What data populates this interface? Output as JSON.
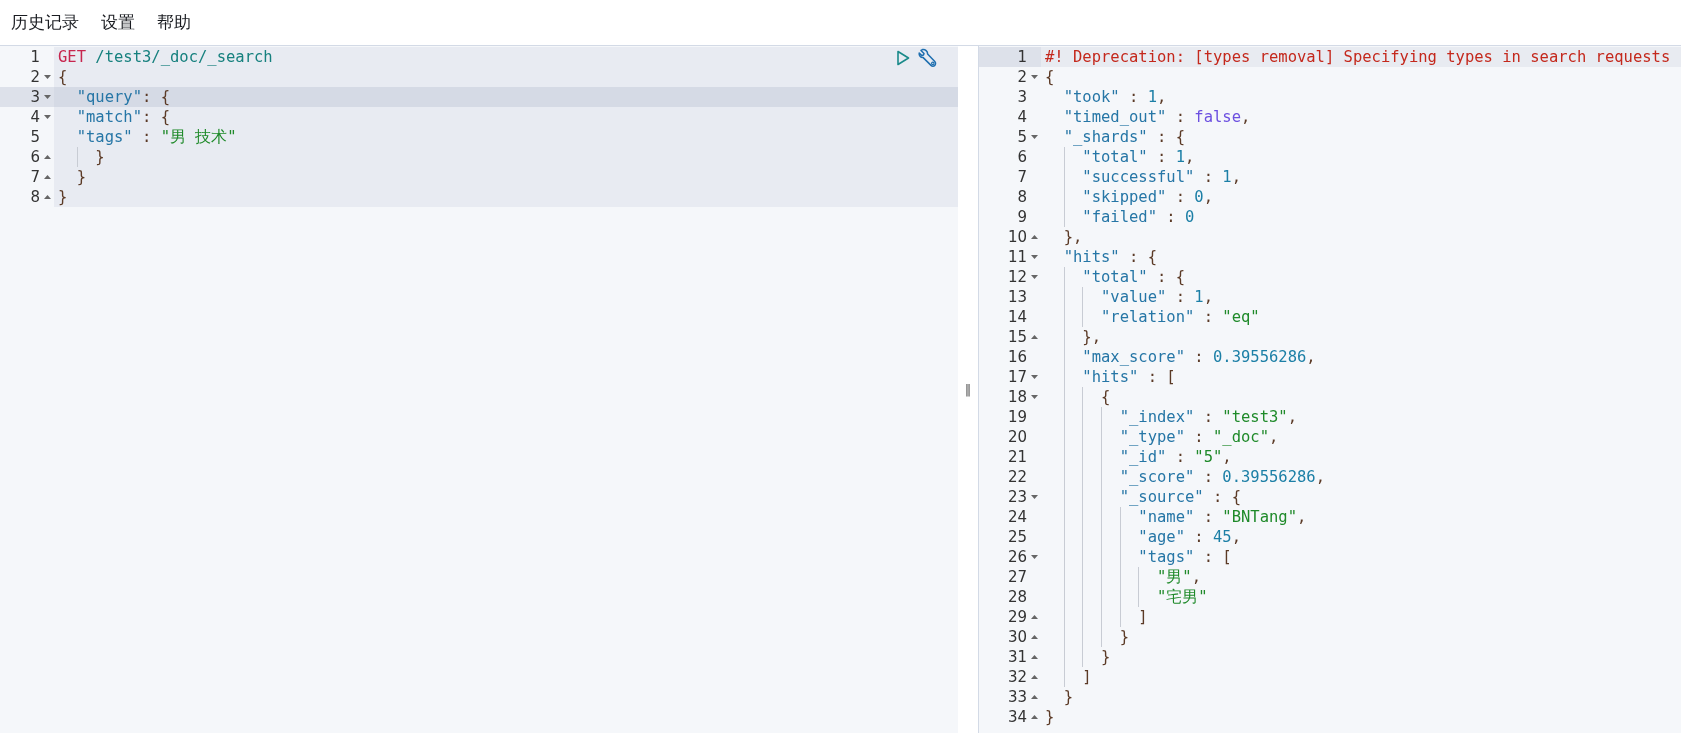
{
  "menu": [
    {
      "label": "历史记录"
    },
    {
      "label": "设置"
    },
    {
      "label": "帮助"
    }
  ],
  "request": {
    "selected": true,
    "lines": [
      {
        "number": "1",
        "active": false,
        "tokens": [
          {
            "kind": "method",
            "text": "GET"
          },
          {
            "kind": "url",
            "text": " /test3/_doc/_search"
          }
        ]
      },
      {
        "number": "2",
        "active": false,
        "expanded": true,
        "tokens": [
          {
            "kind": "punct",
            "text": "{"
          }
        ]
      },
      {
        "number": "3",
        "active": true,
        "expanded": true,
        "tokens": [
          {
            "kind": "key",
            "text": "  \"query\""
          },
          {
            "kind": "punct",
            "text": ": {"
          }
        ]
      },
      {
        "number": "4",
        "active": false,
        "expanded": true,
        "tokens": [
          {
            "kind": "key",
            "text": "  \"match\""
          },
          {
            "kind": "punct",
            "text": ": {"
          }
        ]
      },
      {
        "number": "5",
        "active": false,
        "tokens": [
          {
            "kind": "key",
            "text": "  \"tags\""
          },
          {
            "kind": "punct",
            "text": " : "
          },
          {
            "kind": "string",
            "text": "\"男 技术\""
          }
        ]
      },
      {
        "number": "6",
        "active": false,
        "expanded": false,
        "tokens": [
          {
            "kind": "punct",
            "text": "    }"
          }
        ]
      },
      {
        "number": "7",
        "active": false,
        "expanded": false,
        "tokens": [
          {
            "kind": "punct",
            "text": "  }"
          }
        ]
      },
      {
        "number": "8",
        "active": false,
        "expanded": false,
        "tokens": [
          {
            "kind": "punct",
            "text": "}"
          }
        ]
      }
    ]
  },
  "resize_handle": "‖",
  "response": {
    "lines": [
      {
        "number": "1",
        "active": true,
        "tokens": [
          {
            "kind": "comment",
            "text": "#! Deprecation: [types removal] Specifying types in search requests"
          }
        ]
      },
      {
        "number": "2",
        "active": false,
        "expanded": true,
        "tokens": [
          {
            "kind": "punct",
            "text": "{"
          }
        ]
      },
      {
        "number": "3",
        "active": false,
        "tokens": [
          {
            "kind": "key",
            "text": "  \"took\""
          },
          {
            "kind": "punct",
            "text": " : "
          },
          {
            "kind": "number",
            "text": "1"
          },
          {
            "kind": "punct",
            "text": ","
          }
        ]
      },
      {
        "number": "4",
        "active": false,
        "tokens": [
          {
            "kind": "key",
            "text": "  \"timed_out\""
          },
          {
            "kind": "punct",
            "text": " : "
          },
          {
            "kind": "boolean",
            "text": "false"
          },
          {
            "kind": "punct",
            "text": ","
          }
        ]
      },
      {
        "number": "5",
        "active": false,
        "expanded": true,
        "tokens": [
          {
            "kind": "key",
            "text": "  \"_shards\""
          },
          {
            "kind": "punct",
            "text": " : {"
          }
        ]
      },
      {
        "number": "6",
        "active": false,
        "tokens": [
          {
            "kind": "key",
            "text": "    \"total\""
          },
          {
            "kind": "punct",
            "text": " : "
          },
          {
            "kind": "number",
            "text": "1"
          },
          {
            "kind": "punct",
            "text": ","
          }
        ]
      },
      {
        "number": "7",
        "active": false,
        "tokens": [
          {
            "kind": "key",
            "text": "    \"successful\""
          },
          {
            "kind": "punct",
            "text": " : "
          },
          {
            "kind": "number",
            "text": "1"
          },
          {
            "kind": "punct",
            "text": ","
          }
        ]
      },
      {
        "number": "8",
        "active": false,
        "tokens": [
          {
            "kind": "key",
            "text": "    \"skipped\""
          },
          {
            "kind": "punct",
            "text": " : "
          },
          {
            "kind": "number",
            "text": "0"
          },
          {
            "kind": "punct",
            "text": ","
          }
        ]
      },
      {
        "number": "9",
        "active": false,
        "tokens": [
          {
            "kind": "key",
            "text": "    \"failed\""
          },
          {
            "kind": "punct",
            "text": " : "
          },
          {
            "kind": "number",
            "text": "0"
          }
        ]
      },
      {
        "number": "10",
        "active": false,
        "expanded": false,
        "tokens": [
          {
            "kind": "punct",
            "text": "  },"
          }
        ]
      },
      {
        "number": "11",
        "active": false,
        "expanded": true,
        "tokens": [
          {
            "kind": "key",
            "text": "  \"hits\""
          },
          {
            "kind": "punct",
            "text": " : {"
          }
        ]
      },
      {
        "number": "12",
        "active": false,
        "expanded": true,
        "tokens": [
          {
            "kind": "key",
            "text": "    \"total\""
          },
          {
            "kind": "punct",
            "text": " : {"
          }
        ]
      },
      {
        "number": "13",
        "active": false,
        "tokens": [
          {
            "kind": "key",
            "text": "      \"value\""
          },
          {
            "kind": "punct",
            "text": " : "
          },
          {
            "kind": "number",
            "text": "1"
          },
          {
            "kind": "punct",
            "text": ","
          }
        ]
      },
      {
        "number": "14",
        "active": false,
        "tokens": [
          {
            "kind": "key",
            "text": "      \"relation\""
          },
          {
            "kind": "punct",
            "text": " : "
          },
          {
            "kind": "string",
            "text": "\"eq\""
          }
        ]
      },
      {
        "number": "15",
        "active": false,
        "expanded": false,
        "tokens": [
          {
            "kind": "punct",
            "text": "    },"
          }
        ]
      },
      {
        "number": "16",
        "active": false,
        "tokens": [
          {
            "kind": "key",
            "text": "    \"max_score\""
          },
          {
            "kind": "punct",
            "text": " : "
          },
          {
            "kind": "number",
            "text": "0.39556286"
          },
          {
            "kind": "punct",
            "text": ","
          }
        ]
      },
      {
        "number": "17",
        "active": false,
        "expanded": true,
        "tokens": [
          {
            "kind": "key",
            "text": "    \"hits\""
          },
          {
            "kind": "punct",
            "text": " : ["
          }
        ]
      },
      {
        "number": "18",
        "active": false,
        "expanded": true,
        "tokens": [
          {
            "kind": "punct",
            "text": "      {"
          }
        ]
      },
      {
        "number": "19",
        "active": false,
        "tokens": [
          {
            "kind": "key",
            "text": "        \"_index\""
          },
          {
            "kind": "punct",
            "text": " : "
          },
          {
            "kind": "string",
            "text": "\"test3\""
          },
          {
            "kind": "punct",
            "text": ","
          }
        ]
      },
      {
        "number": "20",
        "active": false,
        "tokens": [
          {
            "kind": "key",
            "text": "        \"_type\""
          },
          {
            "kind": "punct",
            "text": " : "
          },
          {
            "kind": "string",
            "text": "\"_doc\""
          },
          {
            "kind": "punct",
            "text": ","
          }
        ]
      },
      {
        "number": "21",
        "active": false,
        "tokens": [
          {
            "kind": "key",
            "text": "        \"_id\""
          },
          {
            "kind": "punct",
            "text": " : "
          },
          {
            "kind": "string",
            "text": "\"5\""
          },
          {
            "kind": "punct",
            "text": ","
          }
        ]
      },
      {
        "number": "22",
        "active": false,
        "tokens": [
          {
            "kind": "key",
            "text": "        \"_score\""
          },
          {
            "kind": "punct",
            "text": " : "
          },
          {
            "kind": "number",
            "text": "0.39556286"
          },
          {
            "kind": "punct",
            "text": ","
          }
        ]
      },
      {
        "number": "23",
        "active": false,
        "expanded": true,
        "tokens": [
          {
            "kind": "key",
            "text": "        \"_source\""
          },
          {
            "kind": "punct",
            "text": " : {"
          }
        ]
      },
      {
        "number": "24",
        "active": false,
        "tokens": [
          {
            "kind": "key",
            "text": "          \"name\""
          },
          {
            "kind": "punct",
            "text": " : "
          },
          {
            "kind": "string",
            "text": "\"BNTang\""
          },
          {
            "kind": "punct",
            "text": ","
          }
        ]
      },
      {
        "number": "25",
        "active": false,
        "tokens": [
          {
            "kind": "key",
            "text": "          \"age\""
          },
          {
            "kind": "punct",
            "text": " : "
          },
          {
            "kind": "number",
            "text": "45"
          },
          {
            "kind": "punct",
            "text": ","
          }
        ]
      },
      {
        "number": "26",
        "active": false,
        "expanded": true,
        "tokens": [
          {
            "kind": "key",
            "text": "          \"tags\""
          },
          {
            "kind": "punct",
            "text": " : ["
          }
        ]
      },
      {
        "number": "27",
        "active": false,
        "tokens": [
          {
            "kind": "string",
            "text": "            \"男\""
          },
          {
            "kind": "punct",
            "text": ","
          }
        ]
      },
      {
        "number": "28",
        "active": false,
        "tokens": [
          {
            "kind": "string",
            "text": "            \"宅男\""
          }
        ]
      },
      {
        "number": "29",
        "active": false,
        "expanded": false,
        "tokens": [
          {
            "kind": "punct",
            "text": "          ]"
          }
        ]
      },
      {
        "number": "30",
        "active": false,
        "expanded": false,
        "tokens": [
          {
            "kind": "punct",
            "text": "        }"
          }
        ]
      },
      {
        "number": "31",
        "active": false,
        "expanded": false,
        "tokens": [
          {
            "kind": "punct",
            "text": "      }"
          }
        ]
      },
      {
        "number": "32",
        "active": false,
        "expanded": false,
        "tokens": [
          {
            "kind": "punct",
            "text": "    ]"
          }
        ]
      },
      {
        "number": "33",
        "active": false,
        "expanded": false,
        "tokens": [
          {
            "kind": "punct",
            "text": "  }"
          }
        ]
      },
      {
        "number": "34",
        "active": false,
        "expanded": false,
        "tokens": [
          {
            "kind": "punct",
            "text": "}"
          }
        ]
      }
    ]
  }
}
